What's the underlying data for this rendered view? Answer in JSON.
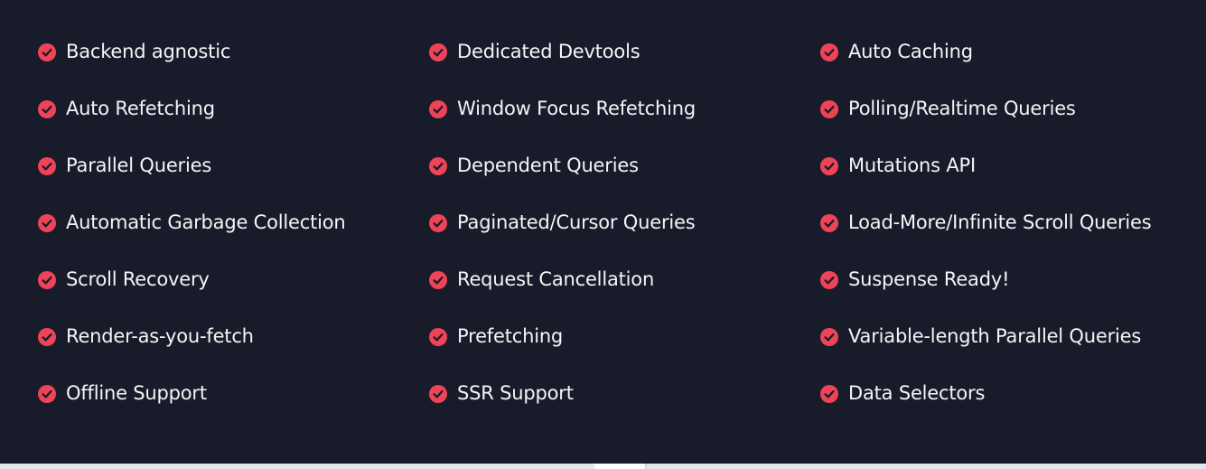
{
  "theme": {
    "background": "#181c2a",
    "accent": "#ef4358",
    "text": "#f4f5f7"
  },
  "features": {
    "columns": [
      [
        {
          "label": "Backend agnostic",
          "icon": "check-circle-icon"
        },
        {
          "label": "Auto Refetching",
          "icon": "check-circle-icon"
        },
        {
          "label": "Parallel Queries",
          "icon": "check-circle-icon"
        },
        {
          "label": "Automatic Garbage Collection",
          "icon": "check-circle-icon"
        },
        {
          "label": "Scroll Recovery",
          "icon": "check-circle-icon"
        },
        {
          "label": "Render-as-you-fetch",
          "icon": "check-circle-icon"
        },
        {
          "label": "Offline Support",
          "icon": "check-circle-icon"
        }
      ],
      [
        {
          "label": "Dedicated Devtools",
          "icon": "check-circle-icon"
        },
        {
          "label": "Window Focus Refetching",
          "icon": "check-circle-icon"
        },
        {
          "label": "Dependent Queries",
          "icon": "check-circle-icon"
        },
        {
          "label": "Paginated/Cursor Queries",
          "icon": "check-circle-icon"
        },
        {
          "label": "Request Cancellation",
          "icon": "check-circle-icon"
        },
        {
          "label": "Prefetching",
          "icon": "check-circle-icon"
        },
        {
          "label": "SSR Support",
          "icon": "check-circle-icon"
        }
      ],
      [
        {
          "label": "Auto Caching",
          "icon": "check-circle-icon"
        },
        {
          "label": "Polling/Realtime Queries",
          "icon": "check-circle-icon"
        },
        {
          "label": "Mutations API",
          "icon": "check-circle-icon"
        },
        {
          "label": "Load-More/Infinite Scroll Queries",
          "icon": "check-circle-icon"
        },
        {
          "label": "Suspense Ready!",
          "icon": "check-circle-icon"
        },
        {
          "label": "Variable-length Parallel Queries",
          "icon": "check-circle-icon"
        },
        {
          "label": "Data Selectors",
          "icon": "check-circle-icon"
        }
      ]
    ]
  }
}
